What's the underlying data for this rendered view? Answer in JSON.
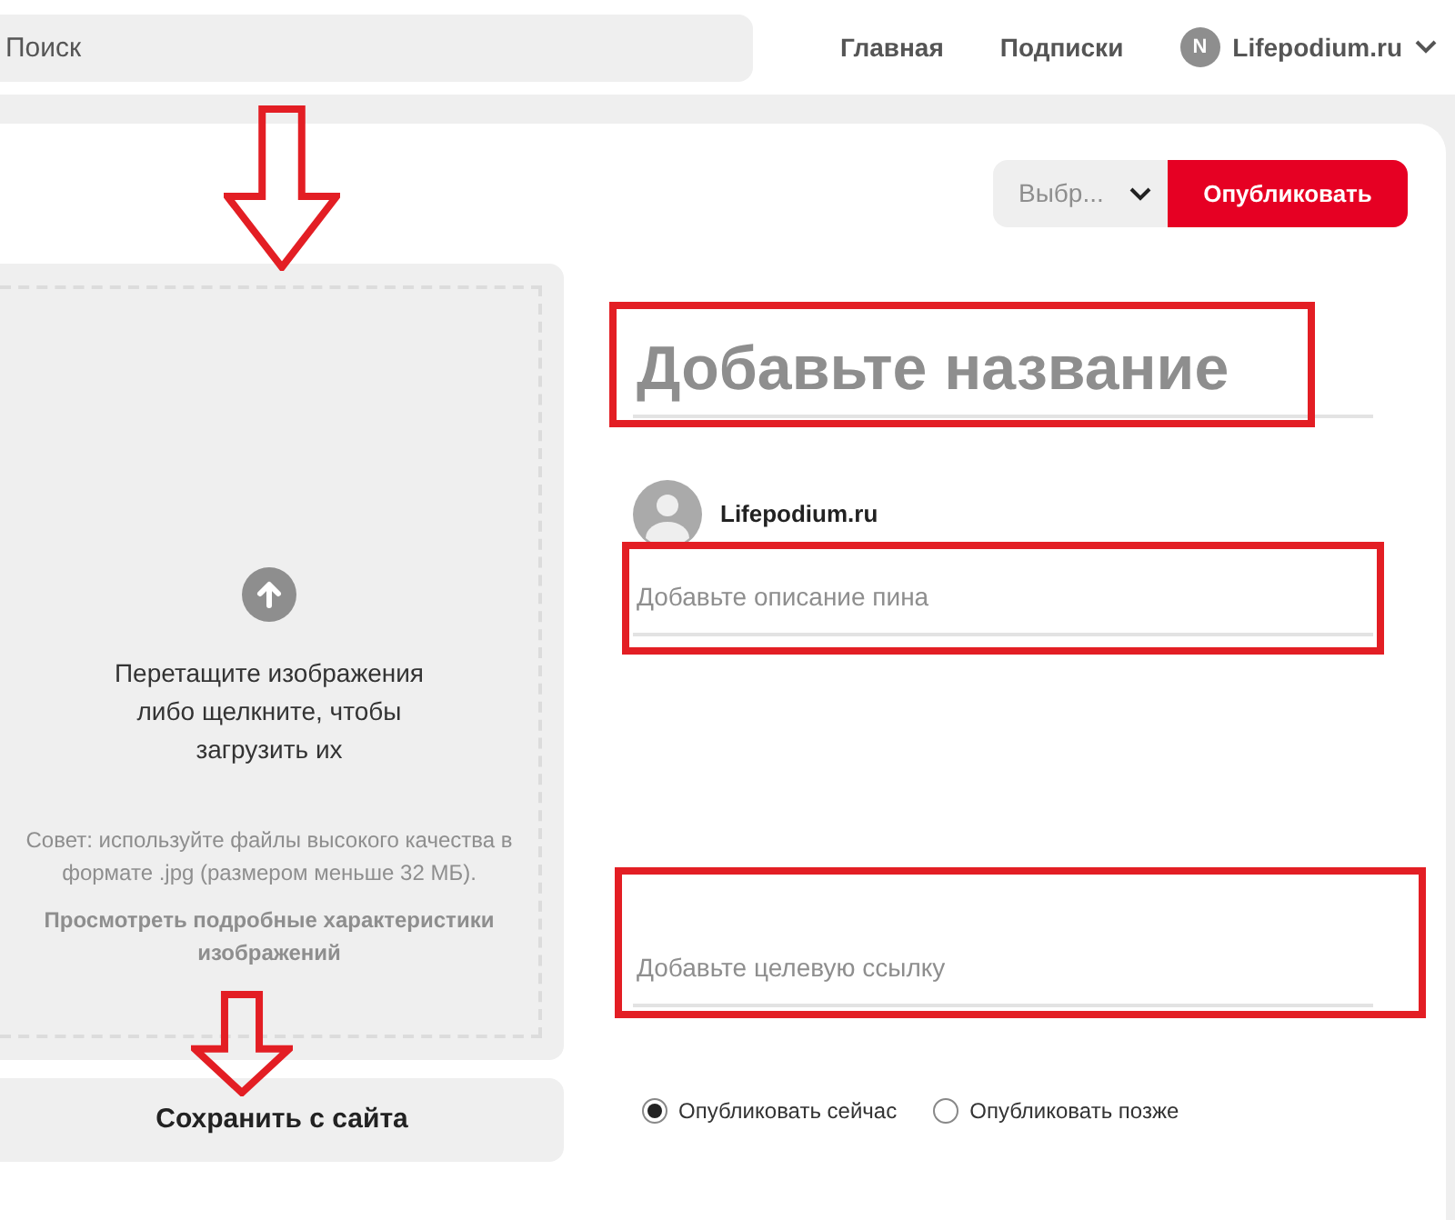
{
  "header": {
    "search": {
      "placeholder": "Поиск"
    },
    "nav": [
      {
        "label": "Главная"
      },
      {
        "label": "Подписки"
      }
    ],
    "account": {
      "initial": "N",
      "name": "Lifepodium.ru"
    }
  },
  "toolbar": {
    "board_select": {
      "value": "Выбр..."
    },
    "publish_button": "Опубликовать"
  },
  "upload": {
    "instruction": "Перетащите изображения либо щелкните, чтобы загрузить их",
    "tip": "Совет: используйте файлы высокого качества в формате .jpg (размером меньше 32 МБ).",
    "details_link": "Просмотреть подробные характеристики изображений",
    "arrow_marker": true
  },
  "save_from_site": {
    "label": "Сохранить с сайта",
    "arrow_marker": true
  },
  "title_field": {
    "placeholder": "Добавьте название",
    "highlighted": true
  },
  "author": {
    "name": "Lifepodium.ru"
  },
  "description_field": {
    "placeholder": "Добавьте описание пина",
    "highlighted": true
  },
  "link_field": {
    "placeholder": "Добавьте целевую ссылку",
    "highlighted": true
  },
  "publish_time": [
    {
      "label": "Опубликовать сейчас",
      "selected": true
    },
    {
      "label": "Опубликовать позже",
      "selected": false
    }
  ]
}
